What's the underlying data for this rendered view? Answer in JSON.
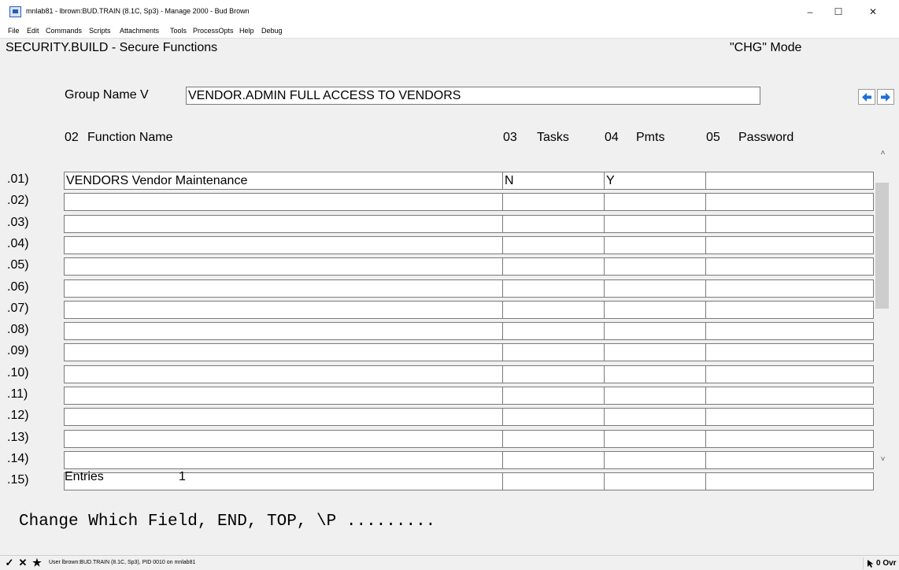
{
  "window": {
    "title": "mnlab81 - lbrown:BUD.TRAIN (8.1C, Sp3) - Manage 2000 - Bud Brown",
    "minimize_glyph": "–",
    "maximize_glyph": "☐",
    "close_glyph": "✕"
  },
  "menu": [
    "File",
    "Edit",
    "Commands",
    "Scripts",
    "Attachments",
    "Tools",
    "ProcessOpts",
    "Help",
    "Debug"
  ],
  "screen": {
    "title": "SECURITY.BUILD - Secure Functions",
    "mode": "\"CHG\" Mode"
  },
  "group": {
    "label": "Group Name V",
    "value": "VENDOR.ADMIN  FULL ACCESS TO VENDORS"
  },
  "nav": {
    "prev_icon": "arrow-left-icon",
    "next_icon": "arrow-right-icon",
    "color": "#1e6fd9"
  },
  "columns": {
    "function_num": "02",
    "function_name": "Function Name",
    "tasks_num": "03",
    "tasks": "Tasks",
    "pmts_num": "04",
    "pmts": "Pmts",
    "password_num": "05",
    "password": "Password"
  },
  "rows": [
    {
      "label": ".01)",
      "function": "VENDORS Vendor Maintenance",
      "tasks": "N",
      "pmts": "Y",
      "password": ""
    },
    {
      "label": ".02)",
      "function": "",
      "tasks": "",
      "pmts": "",
      "password": ""
    },
    {
      "label": ".03)",
      "function": "",
      "tasks": "",
      "pmts": "",
      "password": ""
    },
    {
      "label": ".04)",
      "function": "",
      "tasks": "",
      "pmts": "",
      "password": ""
    },
    {
      "label": ".05)",
      "function": "",
      "tasks": "",
      "pmts": "",
      "password": ""
    },
    {
      "label": ".06)",
      "function": "",
      "tasks": "",
      "pmts": "",
      "password": ""
    },
    {
      "label": ".07)",
      "function": "",
      "tasks": "",
      "pmts": "",
      "password": ""
    },
    {
      "label": ".08)",
      "function": "",
      "tasks": "",
      "pmts": "",
      "password": ""
    },
    {
      "label": ".09)",
      "function": "",
      "tasks": "",
      "pmts": "",
      "password": ""
    },
    {
      "label": ".10)",
      "function": "",
      "tasks": "",
      "pmts": "",
      "password": ""
    },
    {
      "label": ".11)",
      "function": "",
      "tasks": "",
      "pmts": "",
      "password": ""
    },
    {
      "label": ".12)",
      "function": "",
      "tasks": "",
      "pmts": "",
      "password": ""
    },
    {
      "label": ".13)",
      "function": "",
      "tasks": "",
      "pmts": "",
      "password": ""
    },
    {
      "label": ".14)",
      "function": "",
      "tasks": "",
      "pmts": "",
      "password": ""
    },
    {
      "label": ".15)",
      "function": "",
      "tasks": "",
      "pmts": "",
      "password": ""
    }
  ],
  "entries": {
    "label": "Entries",
    "value": "1"
  },
  "prompt": "Change Which Field, END, TOP, \\P .........",
  "statusbar": {
    "check_glyph": "✓",
    "x_glyph": "✕",
    "star_glyph": "★",
    "text": "User lbrown:BUD.TRAIN (8.1C, Sp3), PID 0010 on mnlab81",
    "right_text": "0 Ovr"
  }
}
